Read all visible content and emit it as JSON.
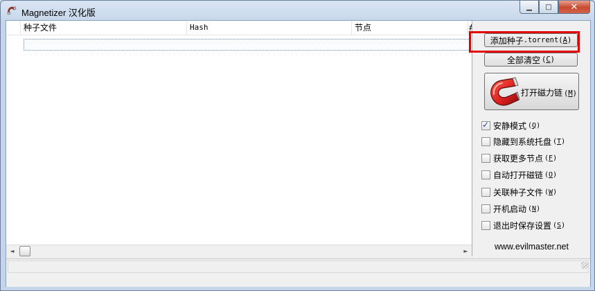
{
  "window": {
    "title": "Magnetizer 汉化版",
    "minimize_glyph": "▁",
    "maximize_glyph": "□",
    "close_glyph": "✕"
  },
  "listview": {
    "columns": [
      "种子文件",
      "Hash",
      "节点",
      "#"
    ]
  },
  "buttons": {
    "add_torrent": {
      "text": "添加种子",
      "mono": ".torrent",
      "key": "A"
    },
    "clear_all": {
      "text": "全部清空",
      "key": "C"
    },
    "open_magnet": {
      "text": "打开磁力链",
      "key": "M"
    }
  },
  "options": [
    {
      "label": "安静模式",
      "key": "Q",
      "checked": true
    },
    {
      "label": "隐藏到系统托盘",
      "key": "T",
      "checked": false
    },
    {
      "label": "获取更多节点",
      "key": "F",
      "checked": false
    },
    {
      "label": "自动打开磁链",
      "key": "O",
      "checked": false
    },
    {
      "label": "关联种子文件",
      "key": "W",
      "checked": false
    },
    {
      "label": "开机启动",
      "key": "N",
      "checked": false
    },
    {
      "label": "退出时保存设置",
      "key": "S",
      "checked": false
    }
  ],
  "website": "www.evilmaster.net",
  "scroll": {
    "left_glyph": "◄",
    "right_glyph": "►"
  },
  "colors": {
    "highlight": "#e00000",
    "magnet_red": "#d81e1e"
  }
}
